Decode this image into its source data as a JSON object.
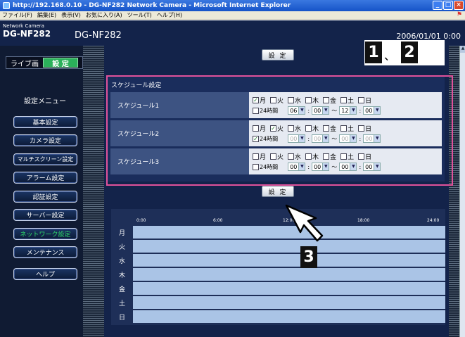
{
  "window": {
    "title": "http://192.168.0.10 - DG-NF282 Network Camera - Microsoft Internet Explorer",
    "menu": [
      "ファイル(F)",
      "編集(E)",
      "表示(V)",
      "お気に入り(A)",
      "ツール(T)",
      "ヘルプ(H)"
    ]
  },
  "header": {
    "model_small_line1": "Network Camera",
    "model_big": "DG-NF282",
    "model_mid": "DG-NF282",
    "datetime": "2006/01/01 0:00"
  },
  "sidebar": {
    "live_label": "ライブ画",
    "setting_label": "設 定",
    "menu_title": "設定メニュー",
    "items": [
      {
        "label": "基本設定"
      },
      {
        "label": "カメラ設定"
      },
      {
        "label": "マルチスクリーン設定"
      },
      {
        "label": "アラーム設定"
      },
      {
        "label": "認証設定"
      },
      {
        "label": "サーバー設定"
      },
      {
        "label": "ネットワーク設定"
      },
      {
        "label": "メンテナンス"
      },
      {
        "label": "ヘルプ"
      }
    ]
  },
  "main": {
    "top_button": "設 定",
    "bottom_button": "設 定",
    "schedule_title": "スケジュール設定",
    "days": [
      "月",
      "火",
      "水",
      "木",
      "金",
      "土",
      "日"
    ],
    "all_day_label": "24時間",
    "range_sep": "〜",
    "schedules": [
      {
        "label": "スケジュール1",
        "checked": [
          true,
          false,
          false,
          false,
          false,
          false,
          false
        ],
        "all_day": false,
        "start_h": "06",
        "start_m": "00",
        "end_h": "12",
        "end_m": "00",
        "disabled": false
      },
      {
        "label": "スケジュール2",
        "checked": [
          false,
          true,
          false,
          false,
          false,
          false,
          false
        ],
        "all_day": true,
        "start_h": "00",
        "start_m": "00",
        "end_h": "00",
        "end_m": "00",
        "disabled": true
      },
      {
        "label": "スケジュール3",
        "checked": [
          false,
          false,
          false,
          false,
          false,
          false,
          false
        ],
        "all_day": false,
        "start_h": "00",
        "start_m": "00",
        "end_h": "00",
        "end_m": "00",
        "disabled": false
      }
    ],
    "timeline_hours": [
      "0:00",
      "6:00",
      "12:00",
      "18:00",
      "24:00"
    ]
  },
  "callouts": {
    "c1": "1",
    "sep": "、",
    "c2": "2",
    "c3": "3"
  }
}
